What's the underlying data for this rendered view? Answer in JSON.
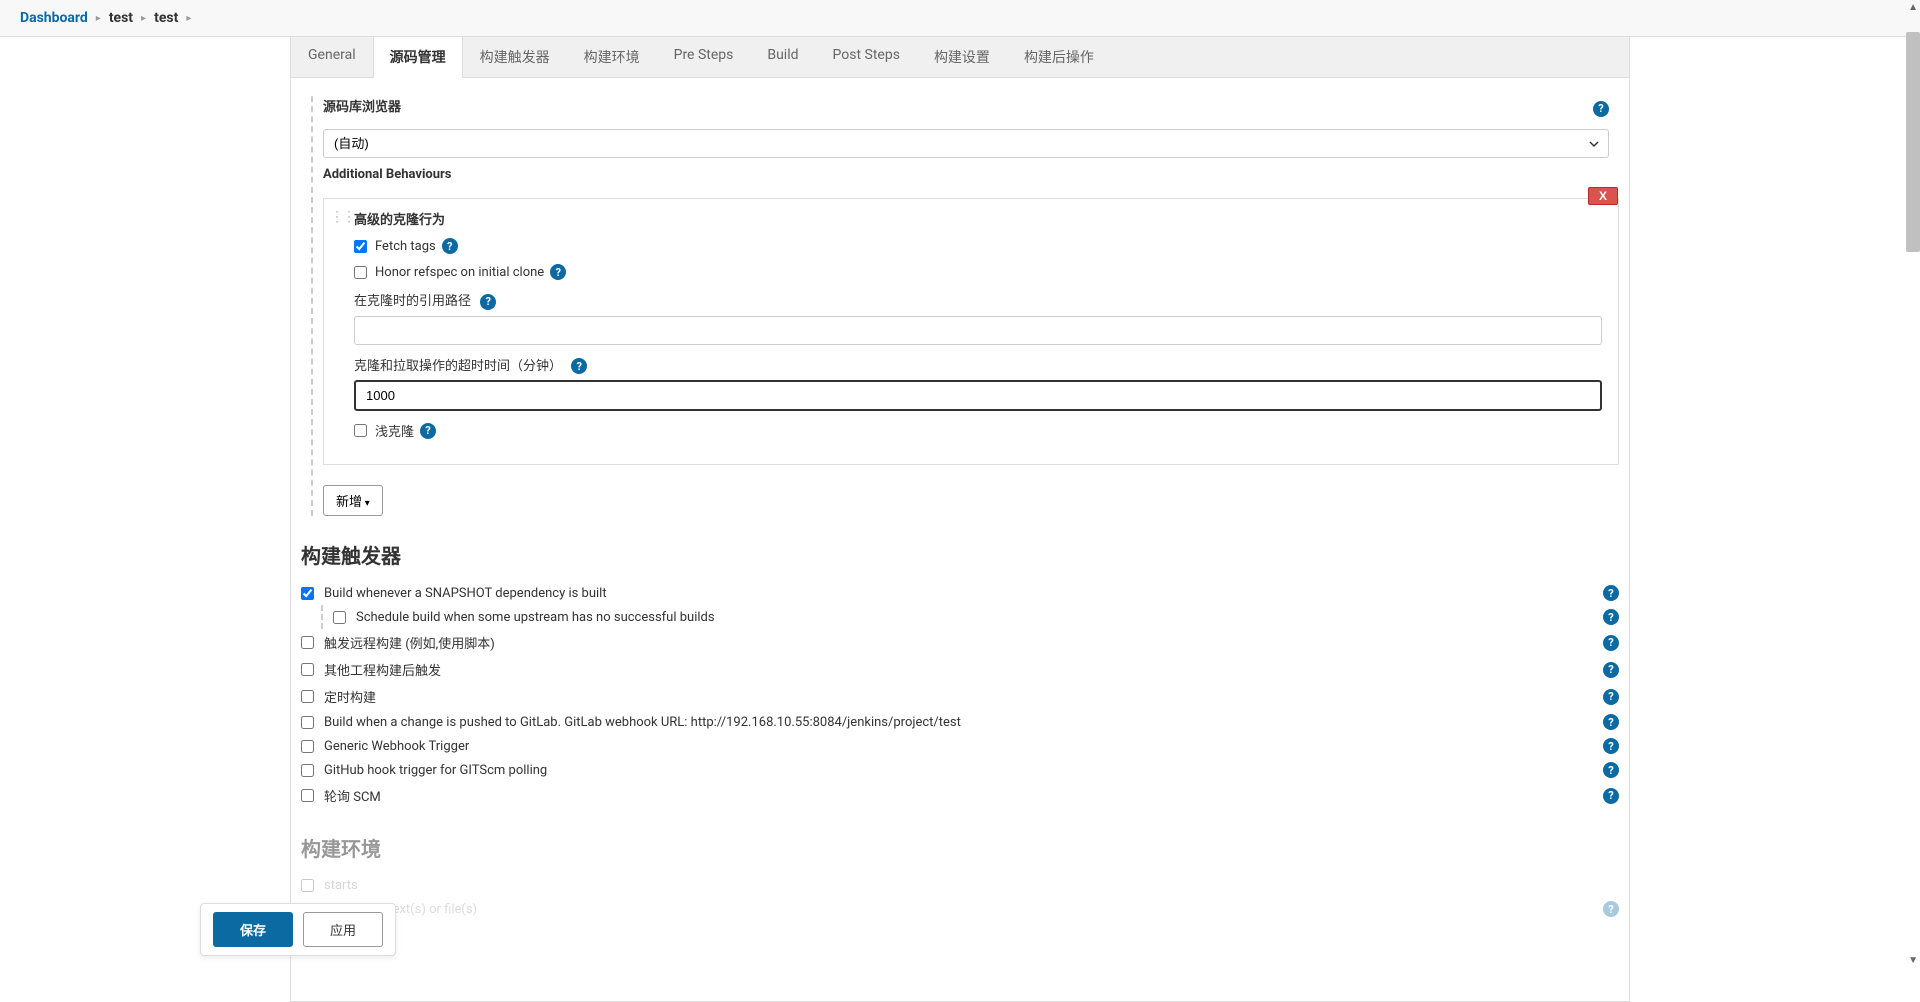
{
  "breadcrumb": {
    "root": "Dashboard",
    "items": [
      "test",
      "test"
    ]
  },
  "tabs": {
    "general": "General",
    "scm": "源码管理",
    "triggers": "构建触发器",
    "env": "构建环境",
    "presteps": "Pre Steps",
    "build": "Build",
    "poststeps": "Post Steps",
    "settings": "构建设置",
    "postactions": "构建后操作"
  },
  "scm": {
    "repo_browser_label": "源码库浏览器",
    "repo_browser_value": "(自动)",
    "additional_behaviours_label": "Additional Behaviours",
    "advanced_clone_title": "高级的克隆行为",
    "delete_label": "X",
    "fetch_tags_label": "Fetch tags",
    "fetch_tags_checked": true,
    "honor_refspec_label": "Honor refspec on initial clone",
    "honor_refspec_checked": false,
    "reference_path_label": "在克隆时的引用路径",
    "reference_path_value": "",
    "timeout_label": "克隆和拉取操作的超时时间（分钟）",
    "timeout_value": "1000",
    "shallow_clone_label": "浅克隆",
    "shallow_clone_checked": false,
    "add_button": "新增"
  },
  "triggers": {
    "heading": "构建触发器",
    "snapshot_label": "Build whenever a SNAPSHOT dependency is built",
    "snapshot_checked": true,
    "schedule_upstream_label": "Schedule build when some upstream has no successful builds",
    "schedule_upstream_checked": false,
    "remote_label": "触发远程构建 (例如,使用脚本)",
    "remote_checked": false,
    "other_proj_label": "其他工程构建后触发",
    "other_proj_checked": false,
    "cron_label": "定时构建",
    "cron_checked": false,
    "gitlab_label": "Build when a change is pushed to GitLab. GitLab webhook URL: http://192.168.10.55:8084/jenkins/project/test",
    "gitlab_checked": false,
    "generic_webhook_label": "Generic Webhook Trigger",
    "generic_webhook_checked": false,
    "github_label": "GitHub hook trigger for GITScm polling",
    "github_checked": false,
    "poll_scm_label": "轮询 SCM",
    "poll_scm_checked": false
  },
  "env": {
    "heading": "构建环境",
    "delete_ws_label_tail": "starts",
    "secret_label": "Use secret text(s) or file(s)"
  },
  "footer": {
    "save": "保存",
    "apply": "应用"
  }
}
